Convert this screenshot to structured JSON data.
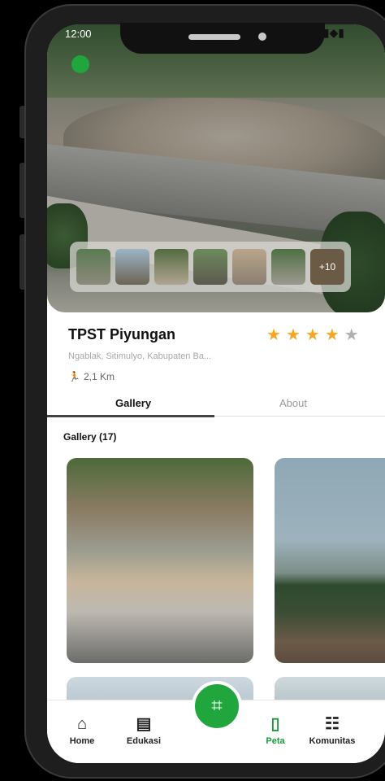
{
  "status_bar": {
    "time": "12:00"
  },
  "place": {
    "name": "TPST Piyungan",
    "address": "Ngablak, Sitimulyo, Kabupaten Ba...",
    "distance": "2,1 Km",
    "rating": 4,
    "max_rating": 5
  },
  "thumbs": {
    "more_label": "+10"
  },
  "tabs": {
    "gallery": "Gallery",
    "about": "About"
  },
  "gallery": {
    "title": "Gallery (17)"
  },
  "nav": {
    "home": "Home",
    "edukasi": "Edukasi",
    "peta": "Peta",
    "komunitas": "Komunitas"
  },
  "colors": {
    "accent": "#21a63e",
    "star_active": "#f5a623",
    "star_inactive": "#b0b0b0"
  }
}
